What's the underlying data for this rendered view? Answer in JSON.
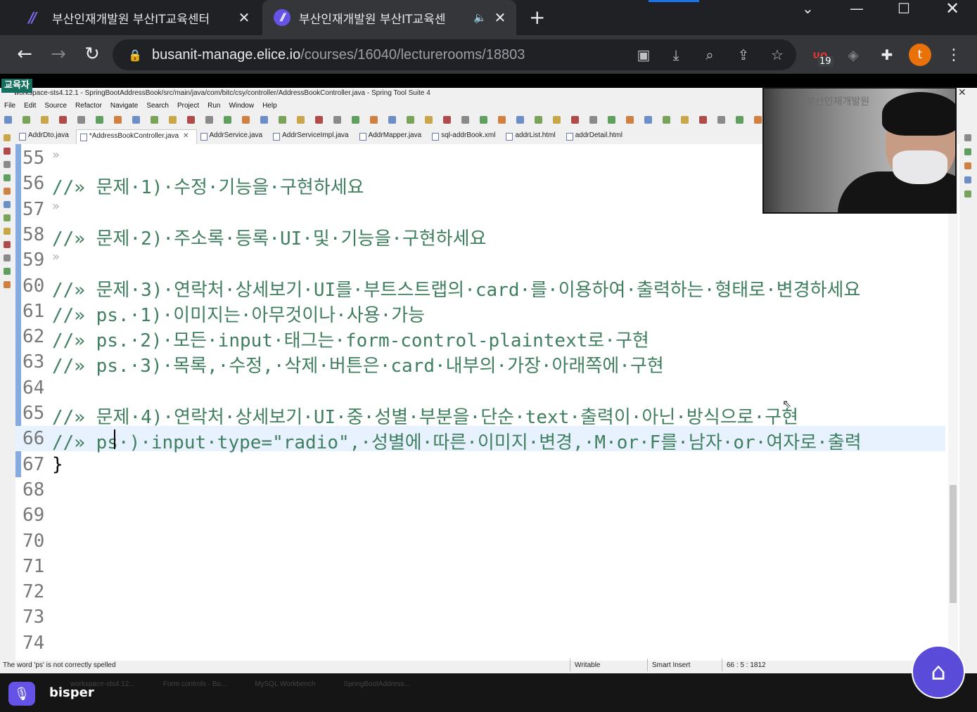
{
  "browser": {
    "tabs": [
      {
        "title": "부산인재개발원 부산IT교육센터",
        "active": false
      },
      {
        "title": "부산인재개발원 부산IT교육센",
        "active": true
      }
    ],
    "url_host": "busanit-manage.elice.io",
    "url_path": "/courses/16040/lecturerooms/18803",
    "extension_badge": "19",
    "profile_initial": "t"
  },
  "overlay": {
    "role_badge": "교육자"
  },
  "ide": {
    "window_title": "workspace-sts4.12.1 - SpringBootAddressBook/src/main/java/com/bitc/csy/controller/AddressBookController.java - Spring Tool Suite 4",
    "menu": [
      "File",
      "Edit",
      "Source",
      "Refactor",
      "Navigate",
      "Search",
      "Project",
      "Run",
      "Window",
      "Help"
    ],
    "tabs": [
      {
        "label": "AddrDto.java",
        "active": false
      },
      {
        "label": "*AddressBookController.java",
        "active": true
      },
      {
        "label": "AddrService.java",
        "active": false
      },
      {
        "label": "AddrServiceImpl.java",
        "active": false
      },
      {
        "label": "AddrMapper.java",
        "active": false
      },
      {
        "label": "sql-addrBook.xml",
        "active": false
      },
      {
        "label": "addrList.html",
        "active": false
      },
      {
        "label": "addrDetail.html",
        "active": false
      }
    ],
    "lines": [
      {
        "num": "55",
        "text": "»"
      },
      {
        "num": "56",
        "text": "//»  문제·1)·수정·기능을·구현하세요"
      },
      {
        "num": "57",
        "text": "»"
      },
      {
        "num": "58",
        "text": "//»  문제·2)·주소록·등록·UI·및·기능을·구현하세요"
      },
      {
        "num": "59",
        "text": "»"
      },
      {
        "num": "60",
        "text": "//»  문제·3)·연락처·상세보기·UI를·부트스트랩의·card·를·이용하여·출력하는·형태로·변경하세요"
      },
      {
        "num": "61",
        "text": "//»  ps.·1)·이미지는·아무것이나·사용·가능"
      },
      {
        "num": "62",
        "text": "//»  ps.·2)·모든·input·태그는·form-control-plaintext로·구현"
      },
      {
        "num": "63",
        "text": "//»  ps.·3)·목록,·수정,·삭제·버튼은·card·내부의·가장·아래쪽에·구현"
      },
      {
        "num": "64",
        "text": ""
      },
      {
        "num": "65",
        "text": "//»  문제·4)·연락처·상세보기·UI·중·성별·부분을·단순·text·출력이·아닌·방식으로·구현"
      },
      {
        "num": "66",
        "text": "//»  ps·)·input·type=\"radio\",·성별에·따른·이미지·변경,·M·or·F를·남자·or·여자로·출력"
      },
      {
        "num": "67",
        "text": "}"
      },
      {
        "num": "68",
        "text": ""
      },
      {
        "num": "69",
        "text": ""
      },
      {
        "num": "70",
        "text": ""
      },
      {
        "num": "71",
        "text": ""
      },
      {
        "num": "72",
        "text": ""
      },
      {
        "num": "73",
        "text": ""
      },
      {
        "num": "74",
        "text": ""
      }
    ],
    "status": {
      "message": "The word 'ps' is not correctly spelled",
      "mode": "Writable",
      "insert": "Smart Insert",
      "position": "66 : 5 : 1812"
    }
  },
  "webcam": {
    "sign_text": "부산인재개발원"
  },
  "taskbar": {
    "faded_items": [
      "workspace-sts4.12...",
      "Form controls · Bo...",
      "MySQL Workbench",
      "SpringBootAddress..."
    ]
  },
  "chat": {
    "speaker_name": "bisper"
  },
  "colors": {
    "accent": "#6453e6",
    "comment": "#3f7f5f",
    "edu_badge": "#16705f",
    "profile": "#e8710a"
  }
}
